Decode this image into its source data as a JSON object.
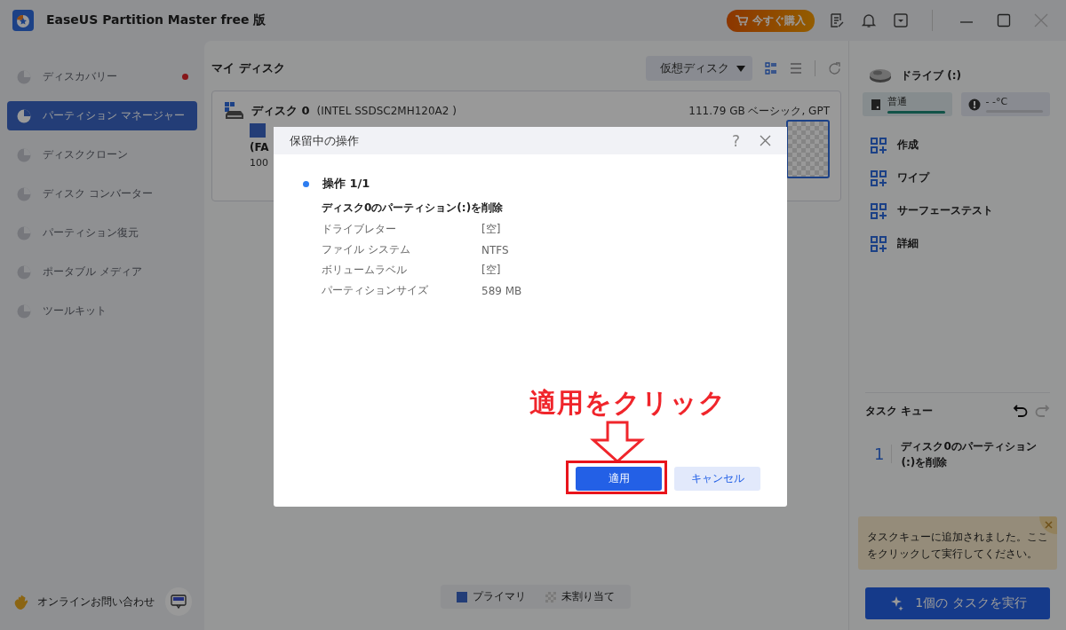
{
  "window": {
    "title": "EaseUS Partition Master free 版",
    "buy_button": "今すぐ購入"
  },
  "sidebar": {
    "items": [
      {
        "label": "ディスカバリー",
        "selected": false,
        "disabled": true,
        "badge_dot": true
      },
      {
        "label": "パーティション マネージャー",
        "selected": true,
        "disabled": false,
        "badge_dot": false
      },
      {
        "label": "ディスククローン",
        "selected": false,
        "disabled": true,
        "badge_dot": false
      },
      {
        "label": "ディスク コンバーター",
        "selected": false,
        "disabled": true,
        "badge_dot": false
      },
      {
        "label": "パーティション復元",
        "selected": false,
        "disabled": true,
        "badge_dot": false
      },
      {
        "label": "ポータブル メディア",
        "selected": false,
        "disabled": true,
        "badge_dot": false
      },
      {
        "label": "ツールキット",
        "selected": false,
        "disabled": true,
        "badge_dot": false
      }
    ],
    "support": "オンラインお問い合わせ"
  },
  "main": {
    "title": "マイ ディスク",
    "disk_filter": "仮想ディスク",
    "disk": {
      "name": "ディスク 0",
      "model": "(INTEL SSDSC2MH120A2 )",
      "info": "111.79 GB ベーシック, GPT",
      "partition": {
        "label": "(FA",
        "size": "100"
      }
    },
    "legend": [
      {
        "label": "プライマリ",
        "kind": "primary"
      },
      {
        "label": "未割り当て",
        "kind": "unallocated"
      }
    ]
  },
  "right_panel": {
    "drive": "ドライブ (:)",
    "health": {
      "label": "普通",
      "level": 1
    },
    "temperature": {
      "label": "- -°C"
    },
    "actions": [
      "作成",
      "ワイプ",
      "サーフェーステスト",
      "詳細"
    ],
    "task_queue": {
      "title": "タスク キュー",
      "redo_disabled": true,
      "items": [
        {
          "number": "1",
          "text": "ディスク0のパーティション(:)を削除"
        }
      ]
    },
    "tooltip": "タスクキューに追加されました。ここをクリックして実行してください。",
    "run_button": "1個の タスクを実行"
  },
  "dialog": {
    "title": "保留中の操作",
    "help": "?",
    "operation": "操作 1/1",
    "description": "ディスク0のパーティション(:)を削除",
    "rows": [
      {
        "label": "ドライブレター",
        "value": "[空]"
      },
      {
        "label": "ファイル システム",
        "value": "NTFS"
      },
      {
        "label": "ボリュームラベル",
        "value": "[空]"
      },
      {
        "label": "パーティションサイズ",
        "value": "589 MB"
      }
    ],
    "apply_button": "適用",
    "cancel_button": "キャンセル"
  },
  "annotation": {
    "text": "適用をクリック"
  }
}
